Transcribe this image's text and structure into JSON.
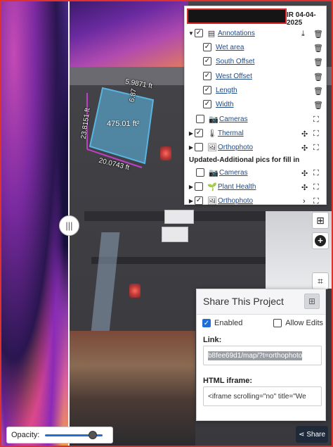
{
  "map": {
    "measurements": {
      "top": "5.9871 ft",
      "right": "6.87",
      "left": "23.8151 ft",
      "bottom": "20.0743 ft",
      "area": "475.01 ft²"
    },
    "divider_handle_glyph": "|||",
    "opacity_label": "Opacity:",
    "opacity_level": 0.82
  },
  "layers": {
    "title_suffix": "IR 04-04-2025",
    "items": [
      {
        "label": "Annotations",
        "checked": true,
        "caret": "▼",
        "icon": "annotation-icon"
      },
      {
        "label": "Wet area",
        "checked": true
      },
      {
        "label": "South Offset",
        "checked": true
      },
      {
        "label": "West Offset",
        "checked": true
      },
      {
        "label": "Length",
        "checked": true
      },
      {
        "label": "Width",
        "checked": true
      },
      {
        "label": "Cameras",
        "checked": false,
        "icon": "camera-icon"
      },
      {
        "label": "Thermal",
        "checked": true,
        "caret": "▶",
        "icon": "thermometer-icon"
      },
      {
        "label": "Orthophoto",
        "checked": false,
        "caret": "▶",
        "icon": "image-icon"
      }
    ],
    "section2_title": "Updated-Additional pics for fill in",
    "items2": [
      {
        "label": "Cameras",
        "checked": false,
        "icon": "camera-icon"
      },
      {
        "label": "Plant Health",
        "checked": false,
        "caret": "▶",
        "icon": "plant-icon"
      },
      {
        "label": "Orthophoto",
        "checked": true,
        "caret": "▶",
        "icon": "image-icon"
      }
    ]
  },
  "share": {
    "title": "Share This Project",
    "enabled_label": "Enabled",
    "enabled": true,
    "allow_edits_label": "Allow Edits",
    "allow_edits": false,
    "link_label": "Link:",
    "link_value": "b8fee69d1/map/?t=orthophoto",
    "iframe_label": "HTML iframe:",
    "iframe_value": "<iframe scrolling=\"no\" title=\"We",
    "button_label": "Share"
  },
  "colors": {
    "accent": "#1f6fd6",
    "polygon_fill": "#5ab4e0",
    "polygon_edge": "#c040c8",
    "highlight_border": "#d92a2a"
  }
}
